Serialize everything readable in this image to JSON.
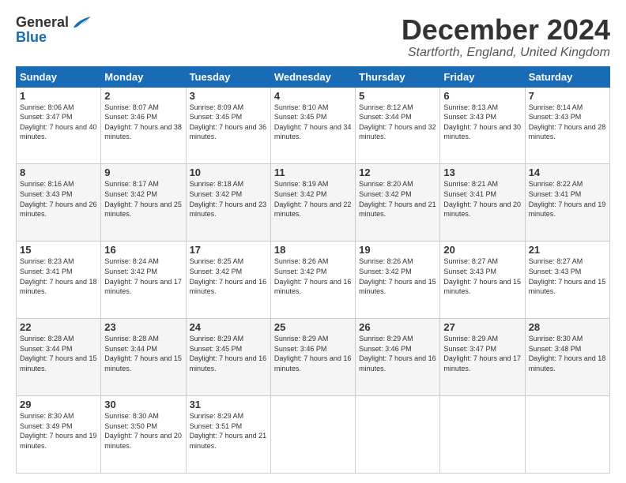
{
  "logo": {
    "line1": "General",
    "line2": "Blue"
  },
  "title": "December 2024",
  "subtitle": "Startforth, England, United Kingdom",
  "days_of_week": [
    "Sunday",
    "Monday",
    "Tuesday",
    "Wednesday",
    "Thursday",
    "Friday",
    "Saturday"
  ],
  "weeks": [
    [
      {
        "day": "1",
        "sunrise": "Sunrise: 8:06 AM",
        "sunset": "Sunset: 3:47 PM",
        "daylight": "Daylight: 7 hours and 40 minutes."
      },
      {
        "day": "2",
        "sunrise": "Sunrise: 8:07 AM",
        "sunset": "Sunset: 3:46 PM",
        "daylight": "Daylight: 7 hours and 38 minutes."
      },
      {
        "day": "3",
        "sunrise": "Sunrise: 8:09 AM",
        "sunset": "Sunset: 3:45 PM",
        "daylight": "Daylight: 7 hours and 36 minutes."
      },
      {
        "day": "4",
        "sunrise": "Sunrise: 8:10 AM",
        "sunset": "Sunset: 3:45 PM",
        "daylight": "Daylight: 7 hours and 34 minutes."
      },
      {
        "day": "5",
        "sunrise": "Sunrise: 8:12 AM",
        "sunset": "Sunset: 3:44 PM",
        "daylight": "Daylight: 7 hours and 32 minutes."
      },
      {
        "day": "6",
        "sunrise": "Sunrise: 8:13 AM",
        "sunset": "Sunset: 3:43 PM",
        "daylight": "Daylight: 7 hours and 30 minutes."
      },
      {
        "day": "7",
        "sunrise": "Sunrise: 8:14 AM",
        "sunset": "Sunset: 3:43 PM",
        "daylight": "Daylight: 7 hours and 28 minutes."
      }
    ],
    [
      {
        "day": "8",
        "sunrise": "Sunrise: 8:16 AM",
        "sunset": "Sunset: 3:43 PM",
        "daylight": "Daylight: 7 hours and 26 minutes."
      },
      {
        "day": "9",
        "sunrise": "Sunrise: 8:17 AM",
        "sunset": "Sunset: 3:42 PM",
        "daylight": "Daylight: 7 hours and 25 minutes."
      },
      {
        "day": "10",
        "sunrise": "Sunrise: 8:18 AM",
        "sunset": "Sunset: 3:42 PM",
        "daylight": "Daylight: 7 hours and 23 minutes."
      },
      {
        "day": "11",
        "sunrise": "Sunrise: 8:19 AM",
        "sunset": "Sunset: 3:42 PM",
        "daylight": "Daylight: 7 hours and 22 minutes."
      },
      {
        "day": "12",
        "sunrise": "Sunrise: 8:20 AM",
        "sunset": "Sunset: 3:42 PM",
        "daylight": "Daylight: 7 hours and 21 minutes."
      },
      {
        "day": "13",
        "sunrise": "Sunrise: 8:21 AM",
        "sunset": "Sunset: 3:41 PM",
        "daylight": "Daylight: 7 hours and 20 minutes."
      },
      {
        "day": "14",
        "sunrise": "Sunrise: 8:22 AM",
        "sunset": "Sunset: 3:41 PM",
        "daylight": "Daylight: 7 hours and 19 minutes."
      }
    ],
    [
      {
        "day": "15",
        "sunrise": "Sunrise: 8:23 AM",
        "sunset": "Sunset: 3:41 PM",
        "daylight": "Daylight: 7 hours and 18 minutes."
      },
      {
        "day": "16",
        "sunrise": "Sunrise: 8:24 AM",
        "sunset": "Sunset: 3:42 PM",
        "daylight": "Daylight: 7 hours and 17 minutes."
      },
      {
        "day": "17",
        "sunrise": "Sunrise: 8:25 AM",
        "sunset": "Sunset: 3:42 PM",
        "daylight": "Daylight: 7 hours and 16 minutes."
      },
      {
        "day": "18",
        "sunrise": "Sunrise: 8:26 AM",
        "sunset": "Sunset: 3:42 PM",
        "daylight": "Daylight: 7 hours and 16 minutes."
      },
      {
        "day": "19",
        "sunrise": "Sunrise: 8:26 AM",
        "sunset": "Sunset: 3:42 PM",
        "daylight": "Daylight: 7 hours and 15 minutes."
      },
      {
        "day": "20",
        "sunrise": "Sunrise: 8:27 AM",
        "sunset": "Sunset: 3:43 PM",
        "daylight": "Daylight: 7 hours and 15 minutes."
      },
      {
        "day": "21",
        "sunrise": "Sunrise: 8:27 AM",
        "sunset": "Sunset: 3:43 PM",
        "daylight": "Daylight: 7 hours and 15 minutes."
      }
    ],
    [
      {
        "day": "22",
        "sunrise": "Sunrise: 8:28 AM",
        "sunset": "Sunset: 3:44 PM",
        "daylight": "Daylight: 7 hours and 15 minutes."
      },
      {
        "day": "23",
        "sunrise": "Sunrise: 8:28 AM",
        "sunset": "Sunset: 3:44 PM",
        "daylight": "Daylight: 7 hours and 15 minutes."
      },
      {
        "day": "24",
        "sunrise": "Sunrise: 8:29 AM",
        "sunset": "Sunset: 3:45 PM",
        "daylight": "Daylight: 7 hours and 16 minutes."
      },
      {
        "day": "25",
        "sunrise": "Sunrise: 8:29 AM",
        "sunset": "Sunset: 3:46 PM",
        "daylight": "Daylight: 7 hours and 16 minutes."
      },
      {
        "day": "26",
        "sunrise": "Sunrise: 8:29 AM",
        "sunset": "Sunset: 3:46 PM",
        "daylight": "Daylight: 7 hours and 16 minutes."
      },
      {
        "day": "27",
        "sunrise": "Sunrise: 8:29 AM",
        "sunset": "Sunset: 3:47 PM",
        "daylight": "Daylight: 7 hours and 17 minutes."
      },
      {
        "day": "28",
        "sunrise": "Sunrise: 8:30 AM",
        "sunset": "Sunset: 3:48 PM",
        "daylight": "Daylight: 7 hours and 18 minutes."
      }
    ],
    [
      {
        "day": "29",
        "sunrise": "Sunrise: 8:30 AM",
        "sunset": "Sunset: 3:49 PM",
        "daylight": "Daylight: 7 hours and 19 minutes."
      },
      {
        "day": "30",
        "sunrise": "Sunrise: 8:30 AM",
        "sunset": "Sunset: 3:50 PM",
        "daylight": "Daylight: 7 hours and 20 minutes."
      },
      {
        "day": "31",
        "sunrise": "Sunrise: 8:29 AM",
        "sunset": "Sunset: 3:51 PM",
        "daylight": "Daylight: 7 hours and 21 minutes."
      },
      null,
      null,
      null,
      null
    ]
  ]
}
